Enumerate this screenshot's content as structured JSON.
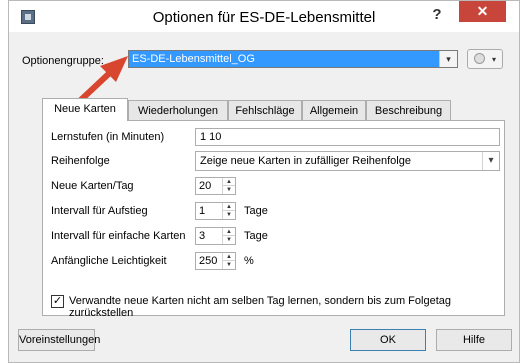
{
  "window": {
    "title": "Optionen für ES-DE-Lebensmittel",
    "help_glyph": "?",
    "close_glyph": "✕"
  },
  "options_group": {
    "label": "Optionengruppe:",
    "value": "ES-DE-Lebensmittel_OG",
    "dropdown_glyph": "▾",
    "gear_glyph": "▾"
  },
  "tabs": [
    {
      "label": "Neue Karten",
      "active": true
    },
    {
      "label": "Wiederholungen",
      "active": false
    },
    {
      "label": "Fehlschläge",
      "active": false
    },
    {
      "label": "Allgemein",
      "active": false
    },
    {
      "label": "Beschreibung",
      "active": false
    }
  ],
  "new_cards": {
    "steps_label": "Lernstufen (in Minuten)",
    "steps_value": "1 10",
    "order_label": "Reihenfolge",
    "order_value": "Zeige neue Karten in zufälliger Reihenfolge",
    "per_day_label": "Neue Karten/Tag",
    "per_day_value": "20",
    "graduating_label": "Intervall für Aufstieg",
    "graduating_value": "1",
    "graduating_unit": "Tage",
    "easy_label": "Intervall für einfache Karten",
    "easy_value": "3",
    "easy_unit": "Tage",
    "ease_label": "Anfängliche Leichtigkeit",
    "ease_value": "250",
    "ease_unit": "%",
    "bury_checked": true,
    "bury_label": "Verwandte neue Karten nicht am selben Tag lernen, sondern bis zum Folgetag zurückstellen"
  },
  "buttons": {
    "defaults": "Voreinstellungen",
    "ok": "OK",
    "help": "Hilfe"
  },
  "colors": {
    "selection": "#3399ff",
    "close": "#c7453a",
    "annotation_arrow": "#d9462f"
  }
}
